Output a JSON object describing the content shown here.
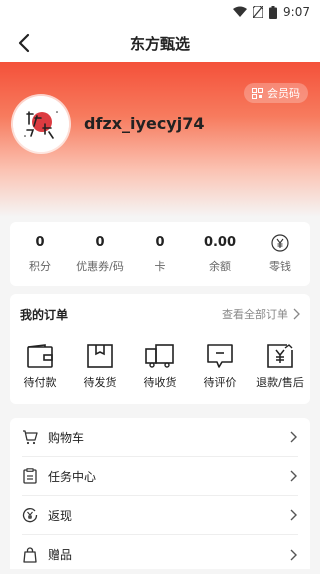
{
  "status": {
    "time": "9:07"
  },
  "nav": {
    "title": "东方甄选"
  },
  "profile": {
    "member_code": "会员码",
    "username": "dfzx_iyecyj74"
  },
  "assets": [
    {
      "value": "0",
      "label": "积分"
    },
    {
      "value": "0",
      "label": "优惠券/码"
    },
    {
      "value": "0",
      "label": "卡"
    },
    {
      "value": "0.00",
      "label": "余额"
    },
    {
      "value": "",
      "label": "零钱"
    }
  ],
  "orders": {
    "title": "我的订单",
    "more": "查看全部订单",
    "items": [
      {
        "label": "待付款"
      },
      {
        "label": "待发货"
      },
      {
        "label": "待收货"
      },
      {
        "label": "待评价"
      },
      {
        "label": "退款/售后"
      }
    ]
  },
  "menu": [
    {
      "label": "购物车"
    },
    {
      "label": "任务中心"
    },
    {
      "label": "返现"
    },
    {
      "label": "赠品"
    }
  ]
}
